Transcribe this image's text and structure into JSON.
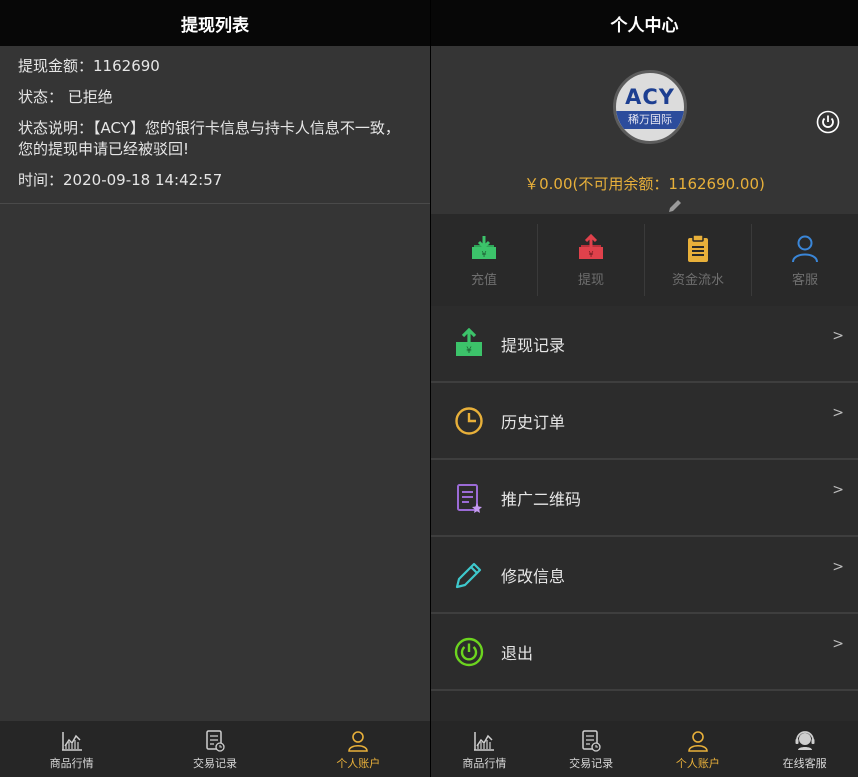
{
  "left": {
    "title": "提现列表",
    "record": {
      "amount_label": "提现金额：",
      "amount_value": "1162690",
      "status_label": "状态：",
      "status_value": "已拒绝",
      "desc_label": "状态说明：",
      "desc_value": "【ACY】您的银行卡信息与持卡人信息不一致，您的提现申请已经被驳回!",
      "time_label": "时间：",
      "time_value": "2020-09-18 14:42:57"
    },
    "nav": [
      {
        "label": "商品行情",
        "icon": "chart-icon"
      },
      {
        "label": "交易记录",
        "icon": "document-icon"
      },
      {
        "label": "个人账户",
        "icon": "user-icon"
      }
    ]
  },
  "right": {
    "title": "个人中心",
    "avatar": {
      "logo_text": "ACY",
      "logo_sub": "稀万国际"
    },
    "balance": "￥0.00(不可用余额：1162690.00)",
    "quick_actions": [
      {
        "label": "充值",
        "icon": "deposit-icon",
        "color": "#3cc36a"
      },
      {
        "label": "提现",
        "icon": "withdraw-icon",
        "color": "#e0414b"
      },
      {
        "label": "资金流水",
        "icon": "clipboard-icon",
        "color": "#e8b03a"
      },
      {
        "label": "客服",
        "icon": "customer-service-icon",
        "color": "#3a86d8"
      }
    ],
    "menu": [
      {
        "label": "提现记录",
        "icon": "withdraw-record-icon",
        "chevron": ">"
      },
      {
        "label": "历史订单",
        "icon": "clock-icon",
        "chevron": ">"
      },
      {
        "label": "推广二维码",
        "icon": "qrcode-doc-icon",
        "chevron": ">"
      },
      {
        "label": "修改信息",
        "icon": "pencil-icon",
        "chevron": ">"
      },
      {
        "label": "退出",
        "icon": "power-icon",
        "chevron": ">"
      }
    ],
    "nav": [
      {
        "label": "商品行情",
        "icon": "chart-icon"
      },
      {
        "label": "交易记录",
        "icon": "document-icon"
      },
      {
        "label": "个人账户",
        "icon": "user-icon"
      },
      {
        "label": "在线客服",
        "icon": "headset-icon"
      }
    ]
  },
  "colors": {
    "accent": "#e8b03a",
    "green": "#3cc36a",
    "red": "#e0414b",
    "blue": "#3a86d8",
    "purple": "#9b6bd6",
    "cyan": "#3ec8cc"
  }
}
